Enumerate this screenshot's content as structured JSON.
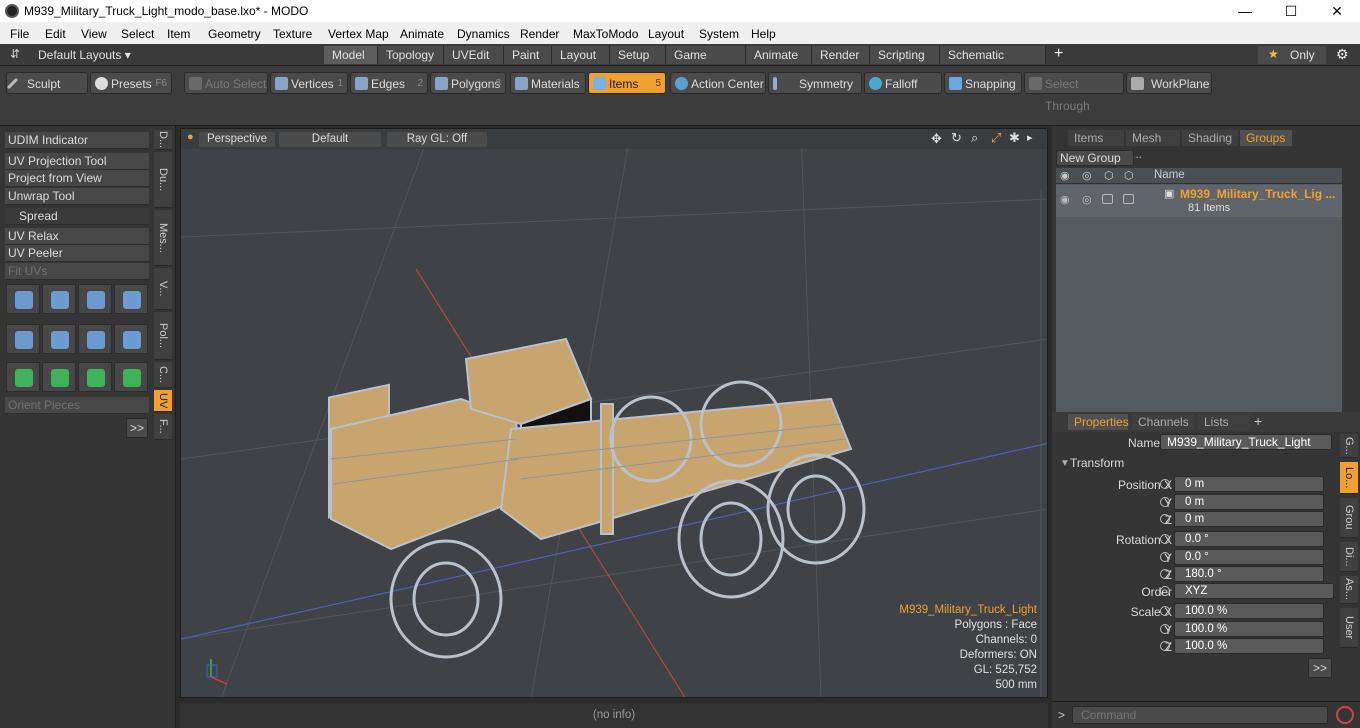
{
  "window": {
    "title": "M939_Military_Truck_Light_modo_base.lxo* - MODO",
    "minimize": "—",
    "maximize": "☐",
    "close": "✕"
  },
  "menu": [
    "File",
    "Edit",
    "View",
    "Select",
    "Item",
    "Geometry",
    "Texture",
    "Vertex Map",
    "Animate",
    "Dynamics",
    "Render",
    "MaxToModo",
    "Layout",
    "System",
    "Help"
  ],
  "layoutbar": {
    "layouts_label": "Default Layouts ▾",
    "tabs": [
      "Model",
      "Topology",
      "UVEdit",
      "Paint",
      "Layout",
      "Setup",
      "Game Tools",
      "Animate",
      "Render",
      "Scripting",
      "Schematic Fusion"
    ],
    "plus": "+",
    "only": "Only",
    "star": "★",
    "gear": "⚙"
  },
  "toolbar": {
    "sculpt": "Sculpt",
    "presets": "Presets",
    "presets_key": "F6",
    "auto_select": "Auto Select",
    "vertices": "Vertices",
    "vertices_n": "1",
    "edges": "Edges",
    "edges_n": "2",
    "polygons": "Polygons",
    "polygons_n": "3",
    "materials": "Materials",
    "items": "Items",
    "items_n": "5",
    "action_center": "Action Center",
    "symmetry": "Symmetry",
    "falloff": "Falloff",
    "snapping": "Snapping",
    "select_through": "Select Through",
    "workplane": "WorkPlane"
  },
  "leftpanel": {
    "buttons": [
      "UDIM Indicator",
      "UV Projection Tool",
      "Project from View",
      "Unwrap Tool",
      "Spread",
      "UV Relax",
      "UV Peeler",
      "Fit UVs",
      "Orient Pieces"
    ],
    "more": ">>",
    "vtabs": [
      "D...",
      "Du...",
      "Mes...",
      "V...",
      "Pol...",
      "C...",
      "UV",
      "F..."
    ]
  },
  "viewport": {
    "view": "Perspective",
    "shading": "Default",
    "raygl": "Ray GL: Off",
    "info": {
      "name": "M939_Military_Truck_Light",
      "polygons": "Polygons : Face",
      "channels": "Channels: 0",
      "deformers": "Deformers: ON",
      "gl": "GL: 525,752",
      "scale": "500 mm"
    }
  },
  "statusbar": "(no info)",
  "rightpanel": {
    "tabs": [
      "Items",
      "Mesh ...",
      "Shading",
      "Groups"
    ],
    "new_group": "New Group",
    "col_name": "Name",
    "group_name": "M939_Military_Truck_Lig ...",
    "group_count": "81 Items",
    "props_tabs": [
      "Properties",
      "Channels",
      "Lists"
    ],
    "plus": "+",
    "side_tabs": [
      "G...",
      "Lo...",
      "Grou",
      "Di...",
      "As...",
      "User"
    ],
    "name_label": "Name",
    "name_value": "M939_Military_Truck_Light",
    "transform": "Transform",
    "rows": [
      {
        "label": "Position X",
        "value": "0 m"
      },
      {
        "label": "Y",
        "value": "0 m"
      },
      {
        "label": "Z",
        "value": "0 m"
      },
      {
        "label": "Rotation X",
        "value": "0.0 °"
      },
      {
        "label": "Y",
        "value": "0.0 °"
      },
      {
        "label": "Z",
        "value": "180.0 °"
      },
      {
        "label": "Order",
        "value": "XYZ"
      },
      {
        "label": "Scale X",
        "value": "100.0 %"
      },
      {
        "label": "Y",
        "value": "100.0 %"
      },
      {
        "label": "Z",
        "value": "100.0 %"
      }
    ],
    "more": ">>"
  },
  "command": {
    "prompt": ">",
    "placeholder": "Command"
  },
  "colors": {
    "accent": "#f0a030",
    "viewport_bg": "#3f4246",
    "truck": "#c8a56e",
    "wire": "#b9c2cc"
  }
}
